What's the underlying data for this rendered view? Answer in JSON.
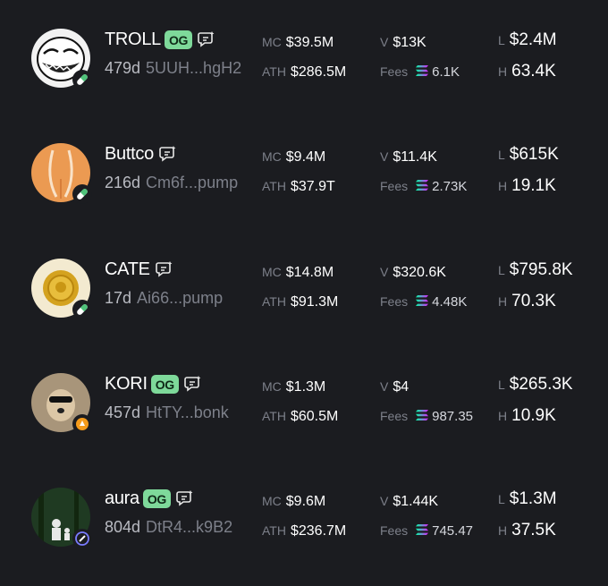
{
  "colors": {
    "background": "#1b1c20",
    "og_badge": "#7ed99a",
    "label": "#7d808a",
    "value": "#ffffff"
  },
  "labels": {
    "mc": "MC",
    "ath": "ATH",
    "v": "V",
    "fees": "Fees",
    "l": "L",
    "h": "H"
  },
  "tokens": [
    {
      "name": "TROLL",
      "og": "OG",
      "age": "479d",
      "address": "5UUH...hgH2",
      "mc": "$39.5M",
      "ath": "$286.5M",
      "volume": "$13K",
      "fees": "6.1K",
      "liquidity": "$2.4M",
      "holders": "63.4K",
      "avatar_icon": "troll-face-icon",
      "platform_icon": "pill-icon"
    },
    {
      "name": "Buttco",
      "og": "",
      "age": "216d",
      "address": "Cm6f...pump",
      "mc": "$9.4M",
      "ath": "$37.9T",
      "volume": "$11.4K",
      "fees": "2.73K",
      "liquidity": "$615K",
      "holders": "19.1K",
      "avatar_icon": "peach-icon",
      "platform_icon": "pill-icon"
    },
    {
      "name": "CATE",
      "og": "",
      "age": "17d",
      "address": "Ai66...pump",
      "mc": "$14.8M",
      "ath": "$91.3M",
      "volume": "$320.6K",
      "fees": "4.48K",
      "liquidity": "$795.8K",
      "holders": "70.3K",
      "avatar_icon": "coin-icon",
      "platform_icon": "pill-icon"
    },
    {
      "name": "KORI",
      "og": "OG",
      "age": "457d",
      "address": "HtTY...bonk",
      "mc": "$1.3M",
      "ath": "$60.5M",
      "volume": "$4",
      "fees": "987.35",
      "liquidity": "$265.3K",
      "holders": "10.9K",
      "avatar_icon": "dog-icon",
      "platform_icon": "bonk-icon"
    },
    {
      "name": "aura",
      "og": "OG",
      "age": "804d",
      "address": "DtR4...k9B2",
      "mc": "$9.6M",
      "ath": "$236.7M",
      "volume": "$1.44K",
      "fees": "745.47",
      "liquidity": "$1.3M",
      "holders": "37.5K",
      "avatar_icon": "forest-icon",
      "platform_icon": "launch-icon"
    }
  ]
}
